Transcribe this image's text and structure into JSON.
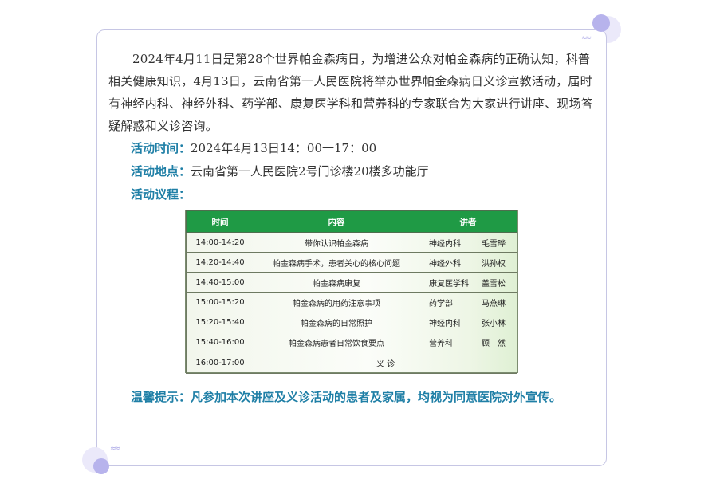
{
  "article": {
    "intro": "2024年4月11日是第28个世界帕金森病日，为增进公众对帕金森病的正确认知，科普相关健康知识，4月13日，云南省第一人民医院将举办世界帕金森病日义诊宣教活动，届时有神经内科、神经外科、药学部、康复医学科和营养科的专家联合为大家进行讲座、现场答疑解惑和义诊咨询。",
    "time_label": "活动时间：",
    "time_value": "2024年4月13日14：00一17：00",
    "place_label": "活动地点：",
    "place_value": "云南省第一人民医院2号门诊楼20楼多功能厅",
    "agenda_label": "活动议程：",
    "tip": "温馨提示：凡参加本次讲座及义诊活动的患者及家属，均视为同意医院对外宣传。"
  },
  "schedule": {
    "headers": [
      "时间",
      "内容",
      "讲者"
    ],
    "rows": [
      {
        "time": "14:00-14:20",
        "topic": "带你认识帕金森病",
        "dept": "神经内科",
        "name": "毛雪晔"
      },
      {
        "time": "14:20-14:40",
        "topic": "帕金森病手术，患者关心的核心问题",
        "dept": "神经外科",
        "name": "洪孙权"
      },
      {
        "time": "14:40-15:00",
        "topic": "帕金森病康复",
        "dept": "康复医学科",
        "name": "盖雪松"
      },
      {
        "time": "15:00-15:20",
        "topic": "帕金森病的用药注意事项",
        "dept": "药学部",
        "name": "马燕琳"
      },
      {
        "time": "15:20-15:40",
        "topic": "帕金森病的日常照护",
        "dept": "神经内科",
        "name": "张小林"
      },
      {
        "time": "15:40-16:00",
        "topic": "帕金森病患者日常饮食要点",
        "dept": "营养科",
        "name": "顾　然"
      }
    ],
    "last_row": {
      "time": "16:00-17:00",
      "topic": "义 诊"
    }
  },
  "colors": {
    "accent": "#1f7fa6",
    "table_header": "#1f9a45",
    "card_border": "#c6c6e4",
    "decor": "#b7b3ec"
  }
}
